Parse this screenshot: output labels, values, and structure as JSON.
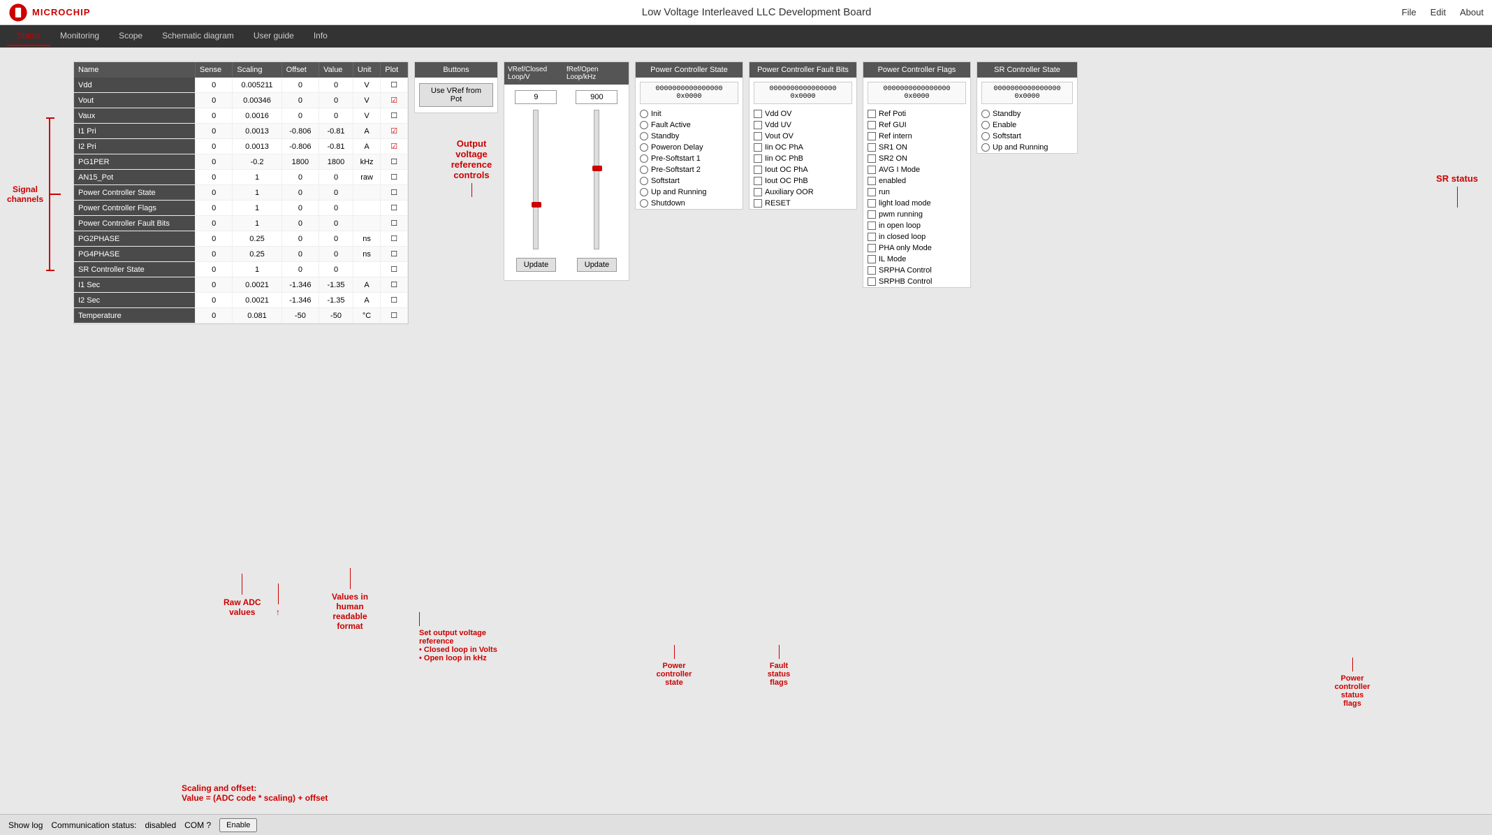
{
  "app": {
    "title": "Low Voltage Interleaved LLC Development Board",
    "logo_text": "Microchip"
  },
  "menu": {
    "items": [
      "File",
      "Edit",
      "About"
    ]
  },
  "nav_tabs": {
    "items": [
      "Status",
      "Monitoring",
      "Scope",
      "Schematic diagram",
      "User guide",
      "Info"
    ],
    "active": "Status"
  },
  "table": {
    "headers": [
      "Name",
      "Sense",
      "Scaling",
      "Offset",
      "Value",
      "Unit",
      "Plot"
    ],
    "rows": [
      {
        "name": "Vdd",
        "sense": "0",
        "scaling": "0.005211",
        "offset": "0",
        "value": "0",
        "unit": "V",
        "plot": false
      },
      {
        "name": "Vout",
        "sense": "0",
        "scaling": "0.00346",
        "offset": "0",
        "value": "0",
        "unit": "V",
        "plot": true
      },
      {
        "name": "Vaux",
        "sense": "0",
        "scaling": "0.0016",
        "offset": "0",
        "value": "0",
        "unit": "V",
        "plot": false
      },
      {
        "name": "I1 Pri",
        "sense": "0",
        "scaling": "0.0013",
        "offset": "-0.806",
        "value": "-0.81",
        "unit": "A",
        "plot": true
      },
      {
        "name": "I2 Pri",
        "sense": "0",
        "scaling": "0.0013",
        "offset": "-0.806",
        "value": "-0.81",
        "unit": "A",
        "plot": true
      },
      {
        "name": "PG1PER",
        "sense": "0",
        "scaling": "-0.2",
        "offset": "1800",
        "value": "1800",
        "unit": "kHz",
        "plot": false
      },
      {
        "name": "AN15_Pot",
        "sense": "0",
        "scaling": "1",
        "offset": "0",
        "value": "0",
        "unit": "raw",
        "plot": false
      },
      {
        "name": "Power Controller State",
        "sense": "0",
        "scaling": "1",
        "offset": "0",
        "value": "0",
        "unit": "",
        "plot": false
      },
      {
        "name": "Power Controller Flags",
        "sense": "0",
        "scaling": "1",
        "offset": "0",
        "value": "0",
        "unit": "",
        "plot": false
      },
      {
        "name": "Power Controller Fault Bits",
        "sense": "0",
        "scaling": "1",
        "offset": "0",
        "value": "0",
        "unit": "",
        "plot": false
      },
      {
        "name": "PG2PHASE",
        "sense": "0",
        "scaling": "0.25",
        "offset": "0",
        "value": "0",
        "unit": "ns",
        "plot": false
      },
      {
        "name": "PG4PHASE",
        "sense": "0",
        "scaling": "0.25",
        "offset": "0",
        "value": "0",
        "unit": "ns",
        "plot": false
      },
      {
        "name": "SR Controller State",
        "sense": "0",
        "scaling": "1",
        "offset": "0",
        "value": "0",
        "unit": "",
        "plot": false
      },
      {
        "name": "I1 Sec",
        "sense": "0",
        "scaling": "0.0021",
        "offset": "-1.346",
        "value": "-1.35",
        "unit": "A",
        "plot": false
      },
      {
        "name": "I2 Sec",
        "sense": "0",
        "scaling": "0.0021",
        "offset": "-1.346",
        "value": "-1.35",
        "unit": "A",
        "plot": false
      },
      {
        "name": "Temperature",
        "sense": "0",
        "scaling": "0.081",
        "offset": "-50",
        "value": "-50",
        "unit": "°C",
        "plot": false
      }
    ]
  },
  "buttons_panel": {
    "header": "Buttons",
    "use_vref_label": "Use VRef from Pot"
  },
  "vref_panel": {
    "header_left": "VRef/Closed Loop/V",
    "header_right": "fRef/Open Loop/kHz",
    "value_left": "9",
    "value_right": "900",
    "update_label": "Update"
  },
  "power_controller_state": {
    "header": "Power Controller State",
    "binary": "0000000000000000",
    "hex": "0x0000",
    "items": [
      "Init",
      "Fault Active",
      "Standby",
      "Poweron Delay",
      "Pre-Softstart 1",
      "Pre-Softstart 2",
      "Softstart",
      "Up and Running",
      "Shutdown"
    ]
  },
  "power_controller_fault": {
    "header": "Power Controller Fault Bits",
    "binary": "0000000000000000",
    "hex": "0x0000",
    "items": [
      "Vdd OV",
      "Vdd UV",
      "Vout OV",
      "Iin OC PhA",
      "Iin OC PhB",
      "Iout OC PhA",
      "Iout OC PhB",
      "Auxiliary OOR",
      "RESET"
    ]
  },
  "power_controller_flags": {
    "header": "Power Controller Flags",
    "binary": "0000000000000000",
    "hex": "0x0000",
    "items": [
      "Ref Poti",
      "Ref GUI",
      "Ref intern",
      "SR1 ON",
      "SR2 ON",
      "AVG I Mode",
      "enabled",
      "run",
      "light load mode",
      "pwm running",
      "in open loop",
      "in closed loop",
      "PHA only Mode",
      "IL Mode",
      "SRPHA Control",
      "SRPHB Control"
    ]
  },
  "sr_controller_state": {
    "header": "SR Controller State",
    "binary": "0000000000000000",
    "hex": "0x0000",
    "items": [
      "Standby",
      "Enable",
      "Softstart",
      "Up and Running"
    ]
  },
  "annotations": {
    "signal_channels": "Signal\nchannels",
    "raw_adc": "Raw ADC\nvalues",
    "scaling_offset": "Scaling and offset:\nValue = (ADC code * scaling) + offset",
    "values_human": "Values in\nhuman\nreadable\nformat",
    "output_voltage": "Output\nvoltage\nreference\ncontrols",
    "set_output": "Set output voltage\nreference\n• Closed loop in Volts\n• Open loop in kHz",
    "power_state": "Power\ncontroller\nstate",
    "fault_flags": "Fault\nstatus\nflags",
    "sr_status": "SR status",
    "pc_flags": "Power\ncontroller\nstatus\nflags"
  },
  "status_bar": {
    "show_log": "Show log",
    "comm_label": "Communication status:",
    "comm_value": "disabled",
    "com_label": "COM ?",
    "enable_label": "Enable"
  }
}
